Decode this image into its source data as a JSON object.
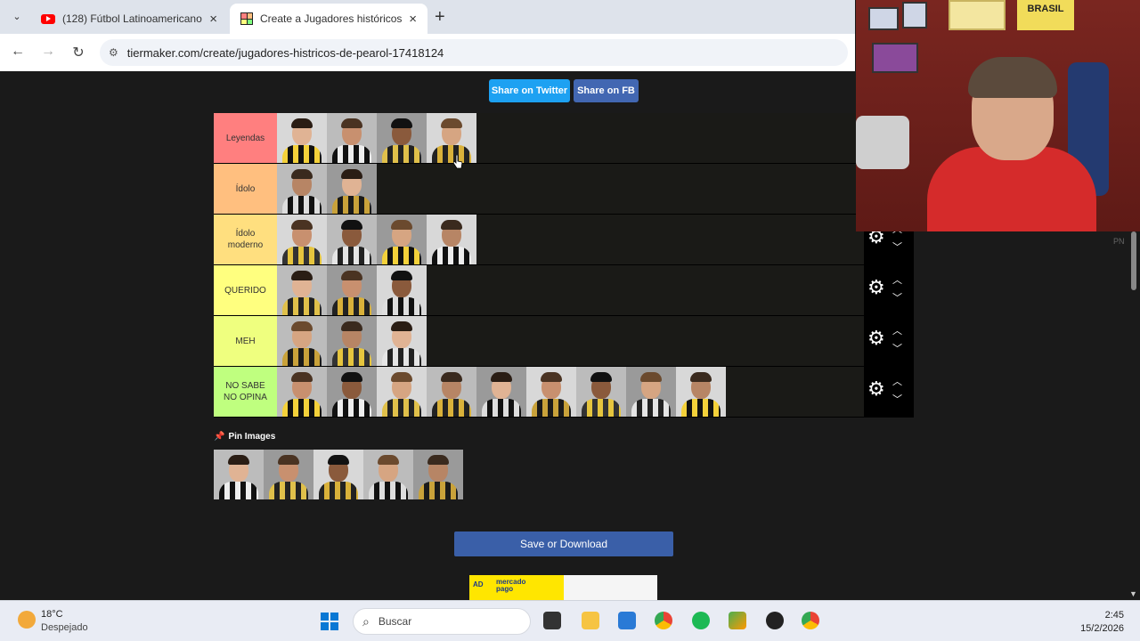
{
  "browser": {
    "tabs": [
      {
        "title": "(128) Fútbol Latinoamericano C",
        "icon": "youtube-icon"
      },
      {
        "title": "Create a Jugadores históricos d",
        "icon": "tiermaker-icon"
      }
    ],
    "url": "tiermaker.com/create/jugadores-histricos-de-pearol-17418124"
  },
  "share": {
    "twitter": "Share on Twitter",
    "facebook": "Share on FB"
  },
  "tiers": [
    {
      "label": "Leyendas",
      "color": "#ff7f7f",
      "count": 4
    },
    {
      "label": "Ídolo",
      "color": "#ffbf7f",
      "count": 2
    },
    {
      "label": "Ídolo moderno",
      "color": "#ffdf7f",
      "count": 4
    },
    {
      "label": "QUERIDO",
      "color": "#ffff7f",
      "count": 3
    },
    {
      "label": "MEH",
      "color": "#efff7f",
      "count": 3
    },
    {
      "label": "NO SABE NO OPINA",
      "color": "#bfff7f",
      "count": 9
    }
  ],
  "pin_images": {
    "label": "Pin Images",
    "count": 5
  },
  "save_button": "Save or Download",
  "ad": {
    "tag": "AD",
    "brand_line1": "mercado",
    "brand_line2": "pago"
  },
  "page_side_text": "PN",
  "webcam": {
    "sign": "BRASIL"
  },
  "taskbar": {
    "weather_temp": "18°C",
    "weather_cond": "Despejado",
    "search_placeholder": "Buscar",
    "time": "2:45",
    "date": "15/2/2026"
  },
  "colors": {
    "tier_bg": "#1a1a17",
    "twitter": "#1da1f2",
    "facebook": "#4267b2",
    "save": "#3a5fa8"
  }
}
